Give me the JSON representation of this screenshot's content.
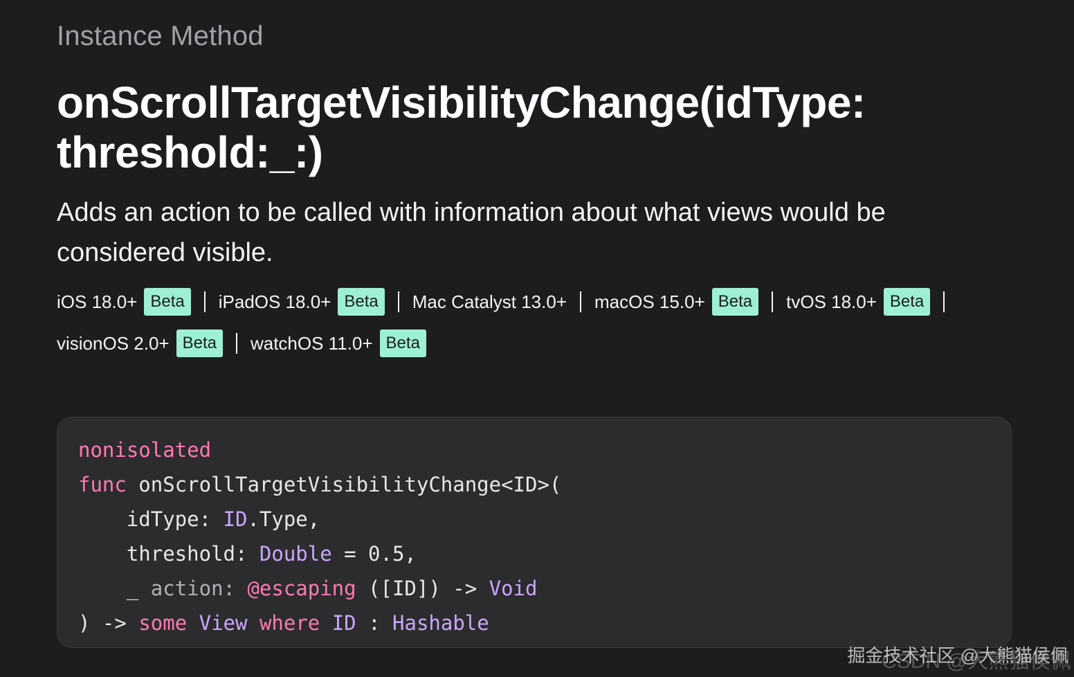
{
  "header": {
    "eyebrow": "Instance Method",
    "title_line1": "onScrollTargetVisibilityChange(idType:",
    "title_line2": "threshold:_:)",
    "abstract": "Adds an action to be called with information about what views would be considered visible."
  },
  "platforms": [
    {
      "name": "iOS 18.0+",
      "badge": "Beta"
    },
    {
      "name": "iPadOS 18.0+",
      "badge": "Beta"
    },
    {
      "name": "Mac Catalyst 13.0+",
      "badge": ""
    },
    {
      "name": "macOS 15.0+",
      "badge": "Beta"
    },
    {
      "name": "tvOS 18.0+",
      "badge": "Beta"
    },
    {
      "name": "visionOS 2.0+",
      "badge": "Beta"
    },
    {
      "name": "watchOS 11.0+",
      "badge": "Beta"
    }
  ],
  "declaration": {
    "line1": {
      "kw": "nonisolated"
    },
    "line2": {
      "kw": "func",
      "name": " onScrollTargetVisibilityChange<ID>("
    },
    "line3": {
      "indent": "    ",
      "label": "idType: ",
      "type": "ID",
      "rest": ".Type,"
    },
    "line4": {
      "indent": "    ",
      "label": "threshold: ",
      "type": "Double",
      "rest": " = 0.5,"
    },
    "line5": {
      "indent": "    ",
      "underscore": "_",
      "label": " action: ",
      "attr": "@escaping",
      "rest": " ([ID]) -> ",
      "type": "Void"
    },
    "line6": {
      "open": ") -> ",
      "kw1": "some",
      "sp1": " ",
      "type1": "View",
      "sp2": " ",
      "kw2": "where",
      "sp3": " ",
      "type2": "ID",
      "rest": " : ",
      "type3": "Hashable"
    }
  },
  "watermark": {
    "text1": "掘金技术社区 @大熊猫侯佩",
    "text2": "CSDN @大熊猫侯佩"
  },
  "colors": {
    "background": "#1d1d1f",
    "code_background": "#2c2c2e",
    "keyword": "#ff7ab2",
    "type": "#c9a6ff",
    "beta_badge": "#9ef0d4"
  }
}
